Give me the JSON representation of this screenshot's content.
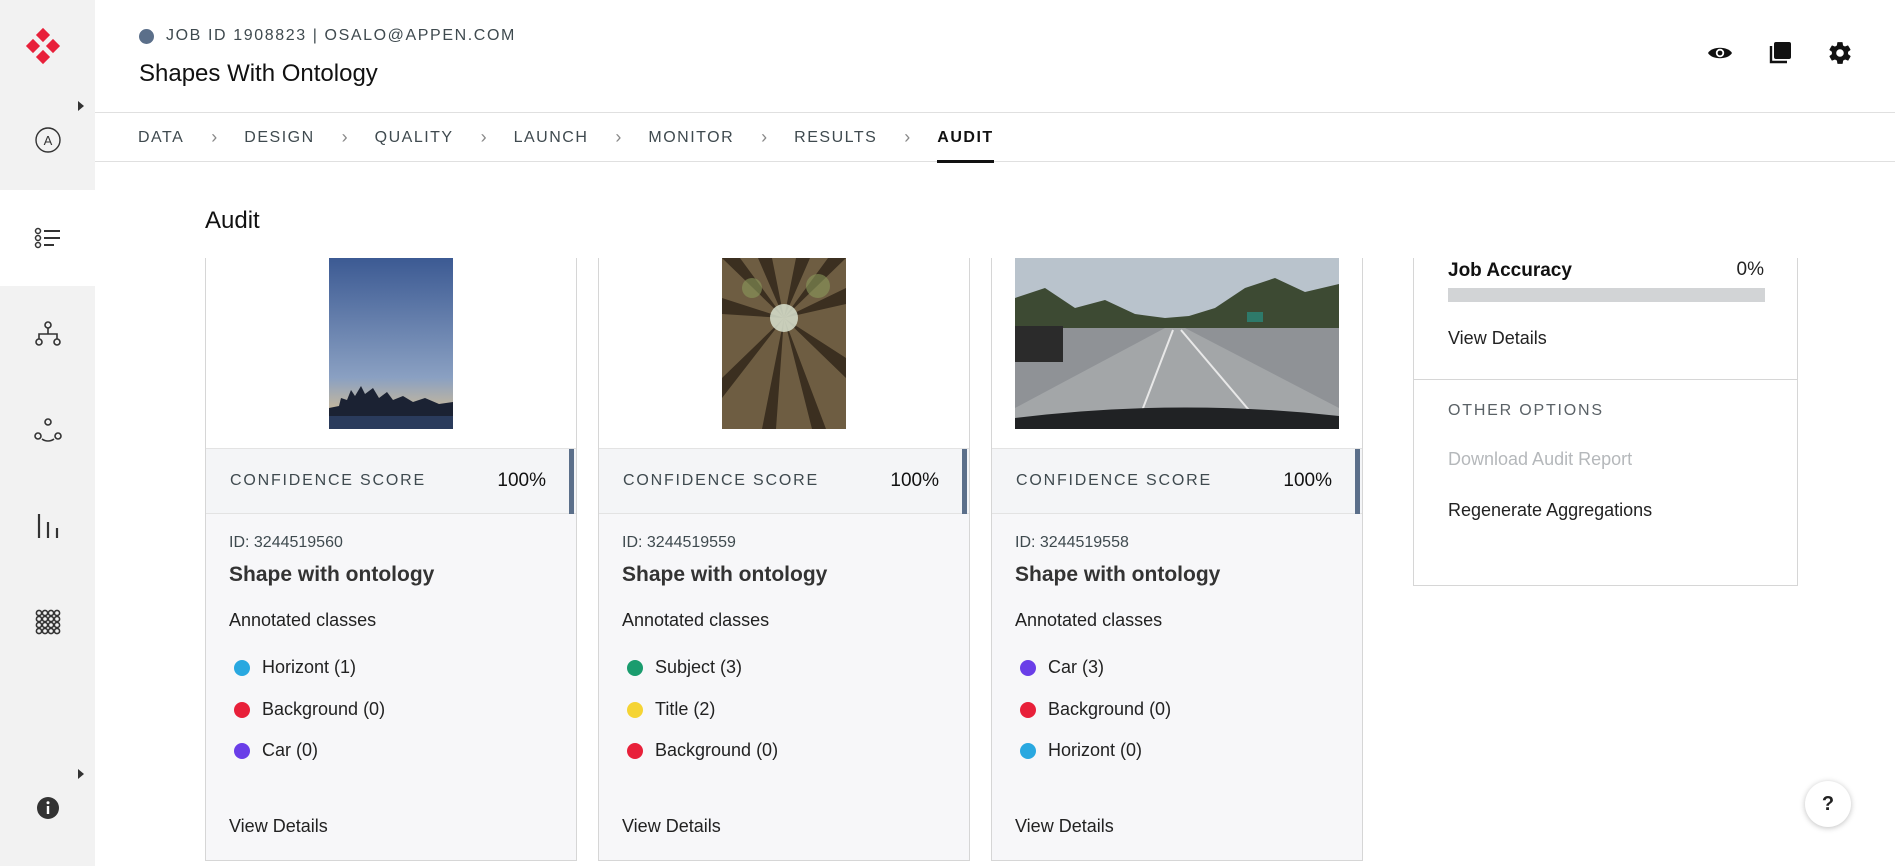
{
  "header": {
    "job_line": "JOB ID 1908823 | OSALO@APPEN.COM",
    "job_title": "Shapes With Ontology"
  },
  "top_icons": [
    "eye-icon",
    "copy-icon",
    "gear-icon"
  ],
  "tabs": [
    {
      "label": "DATA"
    },
    {
      "label": "DESIGN"
    },
    {
      "label": "QUALITY"
    },
    {
      "label": "LAUNCH"
    },
    {
      "label": "MONITOR"
    },
    {
      "label": "RESULTS"
    },
    {
      "label": "AUDIT",
      "active": true
    }
  ],
  "sidebar": {
    "items": [
      "account-icon",
      "jobs-list-icon",
      "workflow-icon",
      "team-icon",
      "analytics-icon",
      "apps-grid-icon"
    ],
    "bottom": "info-icon"
  },
  "page_heading": "Audit",
  "cards": [
    {
      "confidence_label": "CONFIDENCE SCORE",
      "confidence_value": "100%",
      "id_text": "ID: 3244519560",
      "name": "Shape with ontology",
      "annotated_label": "Annotated classes",
      "classes": [
        {
          "label": "Horizont (1)",
          "color": "#29a8e0"
        },
        {
          "label": "Background (0)",
          "color": "#e8203a"
        },
        {
          "label": "Car (0)",
          "color": "#6a3ee8"
        }
      ],
      "view_details": "View Details"
    },
    {
      "confidence_label": "CONFIDENCE SCORE",
      "confidence_value": "100%",
      "id_text": "ID: 3244519559",
      "name": "Shape with ontology",
      "annotated_label": "Annotated classes",
      "classes": [
        {
          "label": "Subject (3)",
          "color": "#1a9c6e"
        },
        {
          "label": "Title (2)",
          "color": "#f5d434"
        },
        {
          "label": "Background (0)",
          "color": "#e8203a"
        }
      ],
      "view_details": "View Details"
    },
    {
      "confidence_label": "CONFIDENCE SCORE",
      "confidence_value": "100%",
      "id_text": "ID: 3244519558",
      "name": "Shape with ontology",
      "annotated_label": "Annotated classes",
      "classes": [
        {
          "label": "Car (3)",
          "color": "#6a3ee8"
        },
        {
          "label": "Background (0)",
          "color": "#e8203a"
        },
        {
          "label": "Horizont (0)",
          "color": "#29a8e0"
        }
      ],
      "view_details": "View Details"
    }
  ],
  "panel": {
    "accuracy_label": "Job Accuracy",
    "accuracy_value": "0%",
    "accuracy_fraction": 0,
    "view_details": "View Details",
    "other_options": "OTHER OPTIONS",
    "download": "Download Audit Report",
    "regenerate": "Regenerate Aggregations"
  },
  "help": "?",
  "colors": {
    "accent": "#5b6f8a",
    "logo": "#e8203a"
  }
}
